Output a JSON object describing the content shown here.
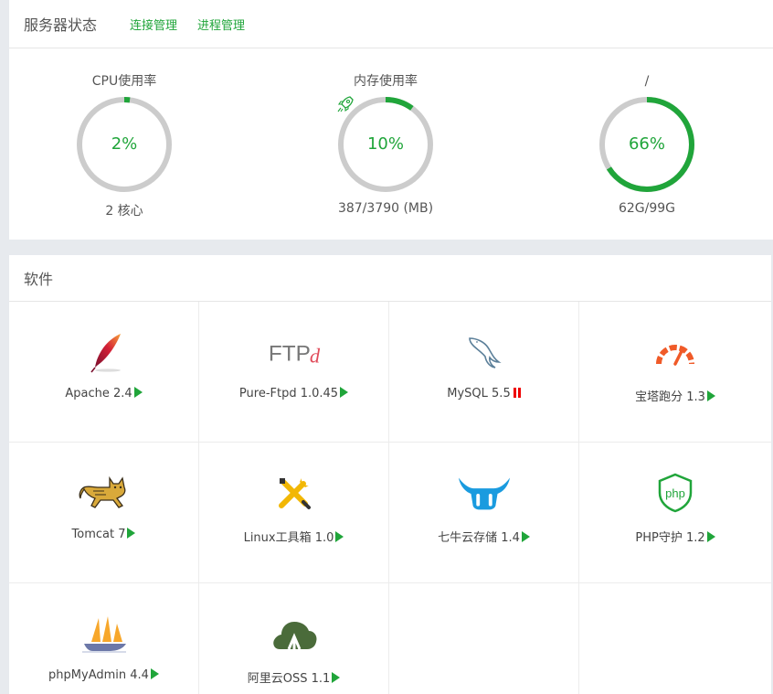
{
  "header": {
    "title": "服务器状态",
    "links": [
      "连接管理",
      "进程管理"
    ]
  },
  "gauges": {
    "cpu": {
      "title": "CPU使用率",
      "value": "2%",
      "percent": 2,
      "sub": "2 核心"
    },
    "mem": {
      "title": "内存使用率",
      "value": "10%",
      "percent": 10,
      "sub": "387/3790 (MB)",
      "icon": "rocket-icon"
    },
    "disk": {
      "title": "/",
      "value": "66%",
      "percent": 66,
      "sub": "62G/99G"
    }
  },
  "software": {
    "title": "软件",
    "items": [
      {
        "label": "Apache 2.4",
        "icon": "apache-feather-icon",
        "state": "play"
      },
      {
        "label": "Pure-Ftpd 1.0.45",
        "icon": "ftpd-logo-icon",
        "state": "play"
      },
      {
        "label": "MySQL 5.5",
        "icon": "mysql-dolphin-icon",
        "state": "pause"
      },
      {
        "label": "宝塔跑分 1.3",
        "icon": "speedometer-icon",
        "state": "play"
      },
      {
        "label": "Tomcat 7",
        "icon": "tomcat-cat-icon",
        "state": "play"
      },
      {
        "label": "Linux工具箱 1.0",
        "icon": "tools-icon",
        "state": "play"
      },
      {
        "label": "七牛云存储 1.4",
        "icon": "qiniu-bull-icon",
        "state": "play"
      },
      {
        "label": "PHP守护 1.2",
        "icon": "php-shield-icon",
        "state": "play"
      },
      {
        "label": "phpMyAdmin 4.4",
        "icon": "sailboat-icon",
        "state": "play"
      },
      {
        "label": "阿里云OSS 1.1",
        "icon": "aliyun-cloud-icon",
        "state": "play"
      }
    ]
  },
  "colors": {
    "accent": "#20a53a",
    "ring_track": "#cccccc",
    "stopped": "#ee0000"
  }
}
